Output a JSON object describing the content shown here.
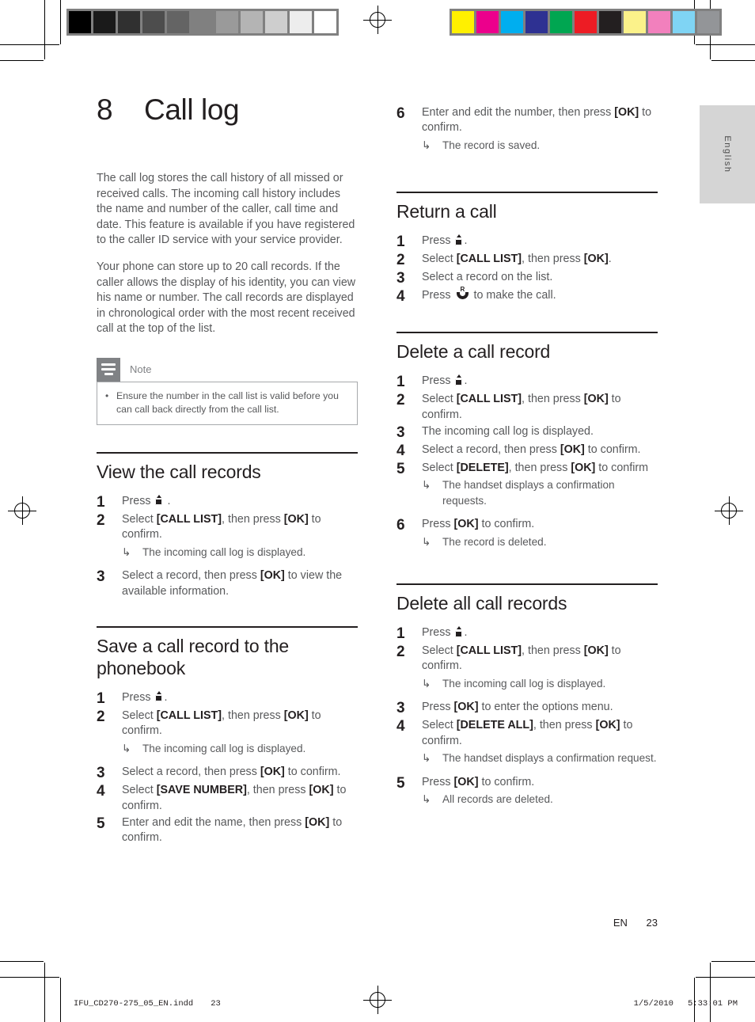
{
  "print_marks": {
    "gray_bar": {
      "name": "grayscale-calibration-bar",
      "swatches": [
        "#000000",
        "#1a1a1a",
        "#303030",
        "#4d4d4d",
        "#646464",
        "#808080",
        "#9a9a9a",
        "#b4b4b4",
        "#cecece",
        "#ededed",
        "#ffffff"
      ]
    },
    "color_bar": {
      "name": "color-calibration-bar",
      "swatches": [
        "#fff000",
        "#ec008c",
        "#00aeef",
        "#2e3192",
        "#00a651",
        "#ed1c24",
        "#231f20",
        "#fbf28a",
        "#f280bd",
        "#7fd4f4",
        "#939598"
      ]
    }
  },
  "language_tab": {
    "label": "English"
  },
  "chapter": {
    "number": "8",
    "title": "Call log"
  },
  "intro": {
    "paragraphs": [
      "The call log stores the call history of all missed or received calls. The incoming call history includes the name and number of the caller, call time and date. This feature is available if you have registered to the caller ID service with your service provider.",
      "Your phone can store up to 20 call records. If the caller allows the display of his identity, you can view his name or number. The call records are displayed in chronological order with the most recent received call at the top of the list."
    ]
  },
  "note": {
    "title": "Note",
    "bullet": "•",
    "text": "Ensure the number in the call list is valid before you can call back directly from the call list."
  },
  "sections": {
    "view_call_records": {
      "heading": "View the call records",
      "steps": [
        {
          "n": "1",
          "pre": "Press ",
          "icon": "phonebook-icon",
          "post": " ."
        },
        {
          "n": "2",
          "html": "Select <b>[CALL LIST]</b>, then press <b>[OK]</b> to confirm.",
          "sub": "The incoming call log is displayed."
        },
        {
          "n": "3",
          "html": "Select a record, then press <b>[OK]</b> to view the available information."
        }
      ]
    },
    "save_call_record": {
      "heading": "Save a call record to the phonebook",
      "steps": [
        {
          "n": "1",
          "pre": "Press ",
          "icon": "phonebook-icon",
          "post": "."
        },
        {
          "n": "2",
          "html": "Select <b>[CALL LIST]</b>, then press <b>[OK]</b> to confirm.",
          "sub": "The incoming call log is displayed."
        },
        {
          "n": "3",
          "html": "Select a record, then press <b>[OK]</b> to confirm."
        },
        {
          "n": "4",
          "html": "Select <b>[SAVE NUMBER]</b>, then press <b>[OK]</b> to confirm."
        },
        {
          "n": "5",
          "html": "Enter and edit the name, then press <b>[OK]</b> to confirm."
        }
      ]
    },
    "save_continued": {
      "steps": [
        {
          "n": "6",
          "html": "Enter and edit the number, then press <b>[OK]</b> to confirm.",
          "sub": "The record is saved."
        }
      ]
    },
    "return_a_call": {
      "heading": "Return a call",
      "steps": [
        {
          "n": "1",
          "pre": "Press ",
          "icon": "phonebook-icon",
          "post": "."
        },
        {
          "n": "2",
          "html": "Select <b>[CALL LIST]</b>, then press <b>[OK]</b>."
        },
        {
          "n": "3",
          "html": "Select a record on the list."
        },
        {
          "n": "4",
          "pre": "Press ",
          "icon": "call-icon",
          "post": " to make the call."
        }
      ]
    },
    "delete_a_call_record": {
      "heading": "Delete a call record",
      "steps": [
        {
          "n": "1",
          "pre": "Press ",
          "icon": "phonebook-icon",
          "post": "."
        },
        {
          "n": "2",
          "html": "Select <b>[CALL LIST]</b>, then press <b>[OK]</b> to confirm."
        },
        {
          "n": "3",
          "html": "The incoming call log is displayed."
        },
        {
          "n": "4",
          "html": "Select a record, then press <b>[OK]</b> to confirm."
        },
        {
          "n": "5",
          "html": "Select <b>[DELETE]</b>, then press <b>[OK]</b> to confirm",
          "sub": "The handset displays a confirmation requests."
        },
        {
          "n": "6",
          "html": "Press <b>[OK]</b> to confirm.",
          "sub": "The record is deleted."
        }
      ]
    },
    "delete_all_call_records": {
      "heading": "Delete all call records",
      "steps": [
        {
          "n": "1",
          "pre": "Press ",
          "icon": "phonebook-icon",
          "post": "."
        },
        {
          "n": "2",
          "html": "Select <b>[CALL LIST]</b>, then press <b>[OK]</b> to confirm.",
          "sub": "The incoming call log is displayed."
        },
        {
          "n": "3",
          "html": "Press <b>[OK]</b> to enter the options menu."
        },
        {
          "n": "4",
          "html": "Select <b>[DELETE ALL]</b>, then press <b>[OK]</b> to confirm.",
          "sub": "The handset displays a confirmation request."
        },
        {
          "n": "5",
          "html": "Press <b>[OK]</b> to confirm.",
          "sub": "All records are deleted."
        }
      ]
    }
  },
  "footer": {
    "locale": "EN",
    "page_number": "23"
  },
  "slug": {
    "filename": "IFU_CD270-275_05_EN.indd",
    "page": "23",
    "date": "1/5/2010",
    "time": "5:33:01 PM"
  },
  "arrow_glyph": "↳"
}
